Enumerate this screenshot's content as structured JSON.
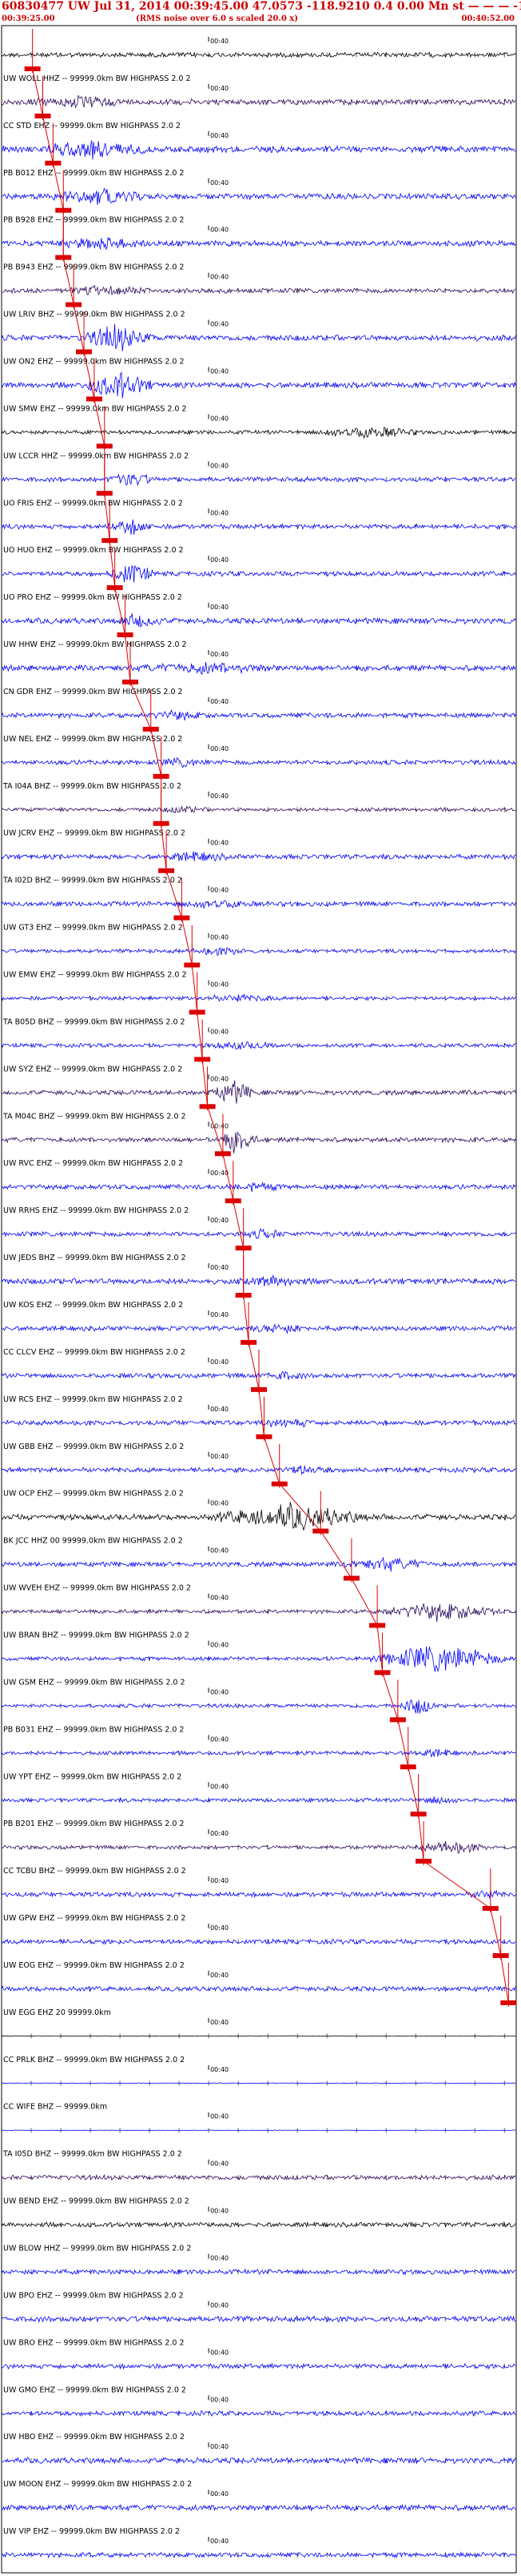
{
  "header": {
    "title": "60830477 UW Jul 31, 2014 00:39:45.00   47.0573 -118.9210  0.4 0.00 Mn st — — — -1",
    "start_time": "00:39:25.00",
    "note": "(RMS noise over 6.0 s scaled 20.0 x)",
    "end_time": "00:40:52.00"
  },
  "colors": {
    "black": "#000000",
    "blue": "#0000ff",
    "purple": "#2a0a5e",
    "red": "#dd0000"
  },
  "chart_data": {
    "type": "seismogram",
    "time_start": "00:39:25.00",
    "time_end": "00:40:52.00",
    "minute_tick_label": "00:40",
    "traces": [
      {
        "label": "",
        "color": "black",
        "amp": 5,
        "burst": null,
        "pick": 0.06
      },
      {
        "label": "UW WOLL HHZ -- 99999.0km BW  HIGHPASS  2.0  2",
        "color": "purple",
        "amp": 6,
        "burst": [
          0.05,
          0.25,
          2
        ],
        "pick": 0.08
      },
      {
        "label": "CC STD EHZ -- 99999.0km BW  HIGHPASS  2.0  2",
        "color": "blue",
        "amp": 7,
        "burst": [
          0.06,
          0.3,
          2.5
        ],
        "pick": 0.1
      },
      {
        "label": "PB B012 EHZ -- 99999.0km BW  HIGHPASS  2.0  2",
        "color": "blue",
        "amp": 6,
        "burst": [
          0.08,
          0.3,
          2.5
        ],
        "pick": 0.12
      },
      {
        "label": "PB B928 EHZ -- 99999.0km BW  HIGHPASS  2.0  2",
        "color": "blue",
        "amp": 6,
        "burst": [
          0.08,
          0.3,
          2
        ],
        "pick": 0.12
      },
      {
        "label": "PB B943 EHZ -- 99999.0km BW  HIGHPASS  2.0  2",
        "color": "purple",
        "amp": 5,
        "burst": [
          0.1,
          0.3,
          2
        ],
        "pick": 0.14
      },
      {
        "label": "UW LRIV BHZ -- 99999.0km BW  HIGHPASS  2.0  2",
        "color": "blue",
        "amp": 6,
        "burst": [
          0.15,
          0.3,
          4
        ],
        "pick": 0.16
      },
      {
        "label": "UW ON2 EHZ -- 99999.0km BW  HIGHPASS  2.0  2",
        "color": "blue",
        "amp": 6,
        "burst": [
          0.15,
          0.3,
          4
        ],
        "pick": 0.18
      },
      {
        "label": "UW SMW EHZ -- 99999.0km BW  HIGHPASS  2.0  2",
        "color": "black",
        "amp": 4,
        "burst": [
          0.6,
          0.82,
          3
        ],
        "pick": 0.2
      },
      {
        "label": "UW LCCR HHZ -- 99999.0km BW  HIGHPASS  2.0  2",
        "color": "blue",
        "amp": 5,
        "burst": [
          0.2,
          0.3,
          3
        ],
        "pick": 0.2
      },
      {
        "label": "UO FRIS EHZ -- 99999.0km BW  HIGHPASS  2.0  2",
        "color": "blue",
        "amp": 5,
        "burst": [
          0.2,
          0.3,
          3
        ],
        "pick": 0.21
      },
      {
        "label": "UO HUO EHZ -- 99999.0km BW  HIGHPASS  2.0  2",
        "color": "blue",
        "amp": 5,
        "burst": [
          0.2,
          0.3,
          4
        ],
        "pick": 0.22
      },
      {
        "label": "UO PRO EHZ -- 99999.0km BW  HIGHPASS  2.0  2",
        "color": "blue",
        "amp": 6,
        "burst": [
          0.22,
          0.32,
          2.5
        ],
        "pick": 0.24
      },
      {
        "label": "UW HHW EHZ -- 99999.0km BW  HIGHPASS  2.0  2",
        "color": "blue",
        "amp": 6,
        "burst": [
          0.25,
          0.55,
          2
        ],
        "pick": 0.25
      },
      {
        "label": "CN GDR EHZ -- 99999.0km BW  HIGHPASS  2.0  2",
        "color": "blue",
        "amp": 5,
        "burst": [
          0.28,
          0.4,
          2
        ],
        "pick": 0.29
      },
      {
        "label": "UW NEL EHZ -- 99999.0km BW  HIGHPASS  2.0  2",
        "color": "blue",
        "amp": 5,
        "burst": [
          0.3,
          0.4,
          2
        ],
        "pick": 0.31
      },
      {
        "label": "TA I04A BHZ -- 99999.0km BW  HIGHPASS  2.0  2",
        "color": "purple",
        "amp": 4,
        "burst": [
          0.3,
          0.4,
          2
        ],
        "pick": 0.31
      },
      {
        "label": "UW JCRV EHZ -- 99999.0km BW  HIGHPASS  2.0  2",
        "color": "blue",
        "amp": 5,
        "burst": [
          0.3,
          0.45,
          2
        ],
        "pick": 0.32
      },
      {
        "label": "TA I02D BHZ -- 99999.0km BW  HIGHPASS  2.0  2",
        "color": "blue",
        "amp": 5,
        "burst": [
          0.34,
          0.5,
          2
        ],
        "pick": 0.35
      },
      {
        "label": "UW GT3 EHZ -- 99999.0km BW  HIGHPASS  2.0  2",
        "color": "blue",
        "amp": 4,
        "burst": [
          0.35,
          0.5,
          2
        ],
        "pick": 0.37
      },
      {
        "label": "UW EMW EHZ -- 99999.0km BW  HIGHPASS  2.0  2",
        "color": "blue",
        "amp": 4,
        "burst": [
          0.37,
          0.55,
          2
        ],
        "pick": 0.38
      },
      {
        "label": "TA B05D BHZ -- 99999.0km BW  HIGHPASS  2.0  2",
        "color": "blue",
        "amp": 4,
        "burst": [
          0.38,
          0.55,
          2
        ],
        "pick": 0.39
      },
      {
        "label": "UW SYZ EHZ -- 99999.0km BW  HIGHPASS  2.0  2",
        "color": "purple",
        "amp": 5,
        "burst": [
          0.4,
          0.5,
          4
        ],
        "pick": 0.4
      },
      {
        "label": "TA M04C BHZ -- 99999.0km BW  HIGHPASS  2.0  2",
        "color": "purple",
        "amp": 5,
        "burst": [
          0.42,
          0.5,
          5
        ],
        "pick": 0.43
      },
      {
        "label": "UW RVC EHZ -- 99999.0km BW  HIGHPASS  2.0  2",
        "color": "blue",
        "amp": 5,
        "burst": [
          0.44,
          0.55,
          2
        ],
        "pick": 0.45
      },
      {
        "label": "UW RRHS EHZ -- 99999.0km BW  HIGHPASS  2.0  2",
        "color": "blue",
        "amp": 5,
        "burst": [
          0.46,
          0.56,
          2
        ],
        "pick": 0.47
      },
      {
        "label": "UW JEDS BHZ -- 99999.0km BW  HIGHPASS  2.0  2",
        "color": "blue",
        "amp": 6,
        "burst": [
          0.46,
          0.6,
          2
        ],
        "pick": 0.47
      },
      {
        "label": "UW KOS EHZ -- 99999.0km BW  HIGHPASS  2.0  2",
        "color": "blue",
        "amp": 5,
        "burst": [
          0.48,
          0.6,
          2
        ],
        "pick": 0.48
      },
      {
        "label": "CC CLCV EHZ -- 99999.0km BW  HIGHPASS  2.0  2",
        "color": "blue",
        "amp": 5,
        "burst": [
          0.49,
          0.6,
          2
        ],
        "pick": 0.5
      },
      {
        "label": "UW RCS EHZ -- 99999.0km BW  HIGHPASS  2.0  2",
        "color": "blue",
        "amp": 5,
        "burst": [
          0.5,
          0.62,
          2
        ],
        "pick": 0.51
      },
      {
        "label": "UW GBB EHZ -- 99999.0km BW  HIGHPASS  2.0  2",
        "color": "blue",
        "amp": 5,
        "burst": [
          0.52,
          0.65,
          2
        ],
        "pick": 0.54
      },
      {
        "label": "UW OCP EHZ -- 99999.0km BW  HIGHPASS  2.0  2",
        "color": "black",
        "amp": 6,
        "burst": [
          0.4,
          0.72,
          4
        ],
        "pick": 0.62
      },
      {
        "label": "BK JCC HHZ 00 99999.0km BW  HIGHPASS  2.0  2",
        "color": "blue",
        "amp": 5,
        "burst": [
          0.65,
          0.85,
          2.5
        ],
        "pick": 0.68
      },
      {
        "label": "UW WVEH EHZ -- 99999.0km BW  HIGHPASS  2.0  2",
        "color": "purple",
        "amp": 4,
        "burst": [
          0.72,
          0.98,
          4
        ],
        "pick": 0.73
      },
      {
        "label": "UW BRAN BHZ -- 99999.0km BW  HIGHPASS  2.0  2",
        "color": "blue",
        "amp": 4,
        "burst": [
          0.7,
          1.0,
          6
        ],
        "pick": 0.74
      },
      {
        "label": "UW GSM EHZ -- 99999.0km BW  HIGHPASS  2.0  2",
        "color": "blue",
        "amp": 4,
        "burst": [
          0.77,
          0.85,
          4
        ],
        "pick": 0.77
      },
      {
        "label": "PB B031 EHZ -- 99999.0km BW  HIGHPASS  2.0  2",
        "color": "blue",
        "amp": 4,
        "burst": [
          0.78,
          0.9,
          2
        ],
        "pick": 0.79
      },
      {
        "label": "UW YPT EHZ -- 99999.0km BW  HIGHPASS  2.0  2",
        "color": "blue",
        "amp": 4,
        "burst": [
          0.8,
          0.9,
          2
        ],
        "pick": 0.81
      },
      {
        "label": "PB B201 EHZ -- 99999.0km BW  HIGHPASS  2.0  2",
        "color": "purple",
        "amp": 4,
        "burst": [
          0.8,
          0.95,
          3
        ],
        "pick": 0.82
      },
      {
        "label": "CC TCBU BHZ -- 99999.0km BW  HIGHPASS  2.0  2",
        "color": "blue",
        "amp": 5,
        "burst": [
          0.9,
          0.98,
          2
        ],
        "pick": 0.95
      },
      {
        "label": "UW GPW EHZ -- 99999.0km BW  HIGHPASS  2.0  2",
        "color": "blue",
        "amp": 5,
        "burst": null,
        "pick": 0.97
      },
      {
        "label": "UW EOG EHZ -- 99999.0km BW  HIGHPASS  2.0  2",
        "color": "blue",
        "amp": 5,
        "burst": null,
        "pick": 0.985
      },
      {
        "label": "UW EGG EHZ 20 99999.0km",
        "color": "black",
        "amp": 0.6,
        "burst": null,
        "pick": null
      },
      {
        "label": "CC PRLK BHZ -- 99999.0km BW  HIGHPASS  2.0  2",
        "color": "blue",
        "amp": 0.8,
        "burst": null,
        "pick": null
      },
      {
        "label": "CC WIFE BHZ -- 99999.0km",
        "color": "blue",
        "amp": 0.6,
        "burst": null,
        "pick": null
      },
      {
        "label": "TA I05D BHZ -- 99999.0km BW  HIGHPASS  2.0  2",
        "color": "purple",
        "amp": 5,
        "burst": null,
        "pick": null
      },
      {
        "label": "UW BEND EHZ -- 99999.0km BW  HIGHPASS  2.0  2",
        "color": "black",
        "amp": 5,
        "burst": null,
        "pick": null
      },
      {
        "label": "UW BLOW HHZ -- 99999.0km BW  HIGHPASS  2.0  2",
        "color": "blue",
        "amp": 5,
        "burst": null,
        "pick": null
      },
      {
        "label": "UW BPO EHZ -- 99999.0km BW  HIGHPASS  2.0  2",
        "color": "blue",
        "amp": 6,
        "burst": null,
        "pick": null
      },
      {
        "label": "UW BRO EHZ -- 99999.0km BW  HIGHPASS  2.0  2",
        "color": "blue",
        "amp": 5,
        "burst": null,
        "pick": null
      },
      {
        "label": "UW GMO EHZ -- 99999.0km BW  HIGHPASS  2.0  2",
        "color": "blue",
        "amp": 5,
        "burst": null,
        "pick": null
      },
      {
        "label": "UW HBO EHZ -- 99999.0km BW  HIGHPASS  2.0  2",
        "color": "blue",
        "amp": 6,
        "burst": null,
        "pick": null
      },
      {
        "label": "UW MOON EHZ -- 99999.0km BW  HIGHPASS  2.0  2",
        "color": "blue",
        "amp": 6,
        "burst": null,
        "pick": null
      },
      {
        "label": "UW VIP EHZ -- 99999.0km BW  HIGHPASS  2.0  2",
        "color": "blue",
        "amp": 5,
        "burst": null,
        "pick": null
      }
    ]
  }
}
